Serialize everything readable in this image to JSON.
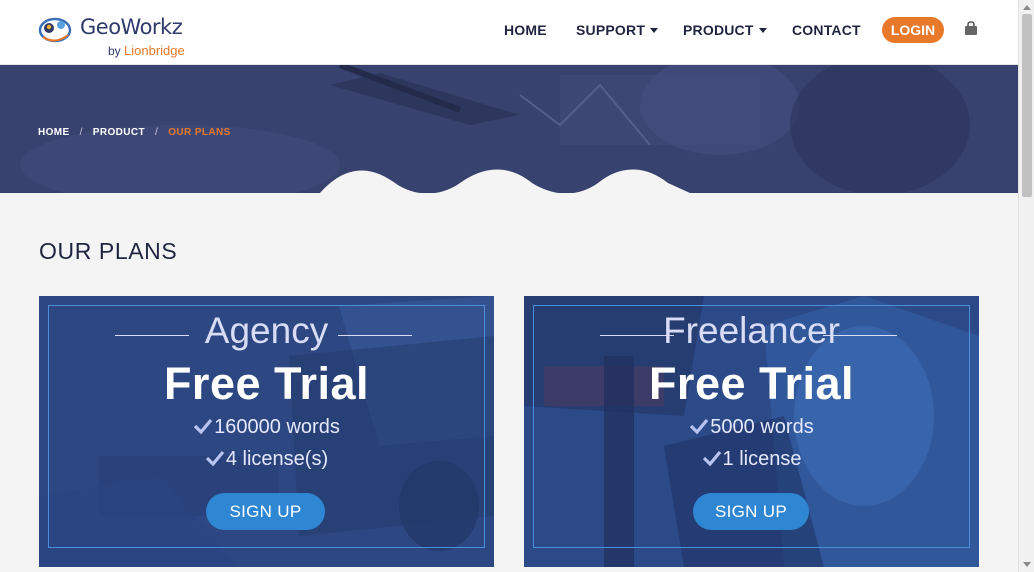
{
  "brand": {
    "name": "GeoWorkz",
    "by": "by",
    "parent": "Lionbridge"
  },
  "nav": {
    "home": "HOME",
    "support": "SUPPORT",
    "product": "PRODUCT",
    "contact": "CONTACT",
    "login": "LOGIN"
  },
  "breadcrumb": {
    "items": [
      "HOME",
      "PRODUCT",
      "OUR PLANS"
    ],
    "separator": "/"
  },
  "page": {
    "title": "OUR PLANS"
  },
  "plans": [
    {
      "name": "Agency",
      "price": "Free Trial",
      "features": [
        "160000 words",
        "4 license(s)"
      ],
      "cta": "SIGN UP"
    },
    {
      "name": "Freelancer",
      "price": "Free Trial",
      "features": [
        "5000 words",
        "1 license"
      ],
      "cta": "SIGN UP"
    }
  ],
  "colors": {
    "accent": "#e8782a",
    "navy": "#1f2540",
    "banner": "#38426e",
    "button": "#2f86d2"
  },
  "icons": [
    "cart-icon",
    "check-icon",
    "caret-down-icon"
  ]
}
